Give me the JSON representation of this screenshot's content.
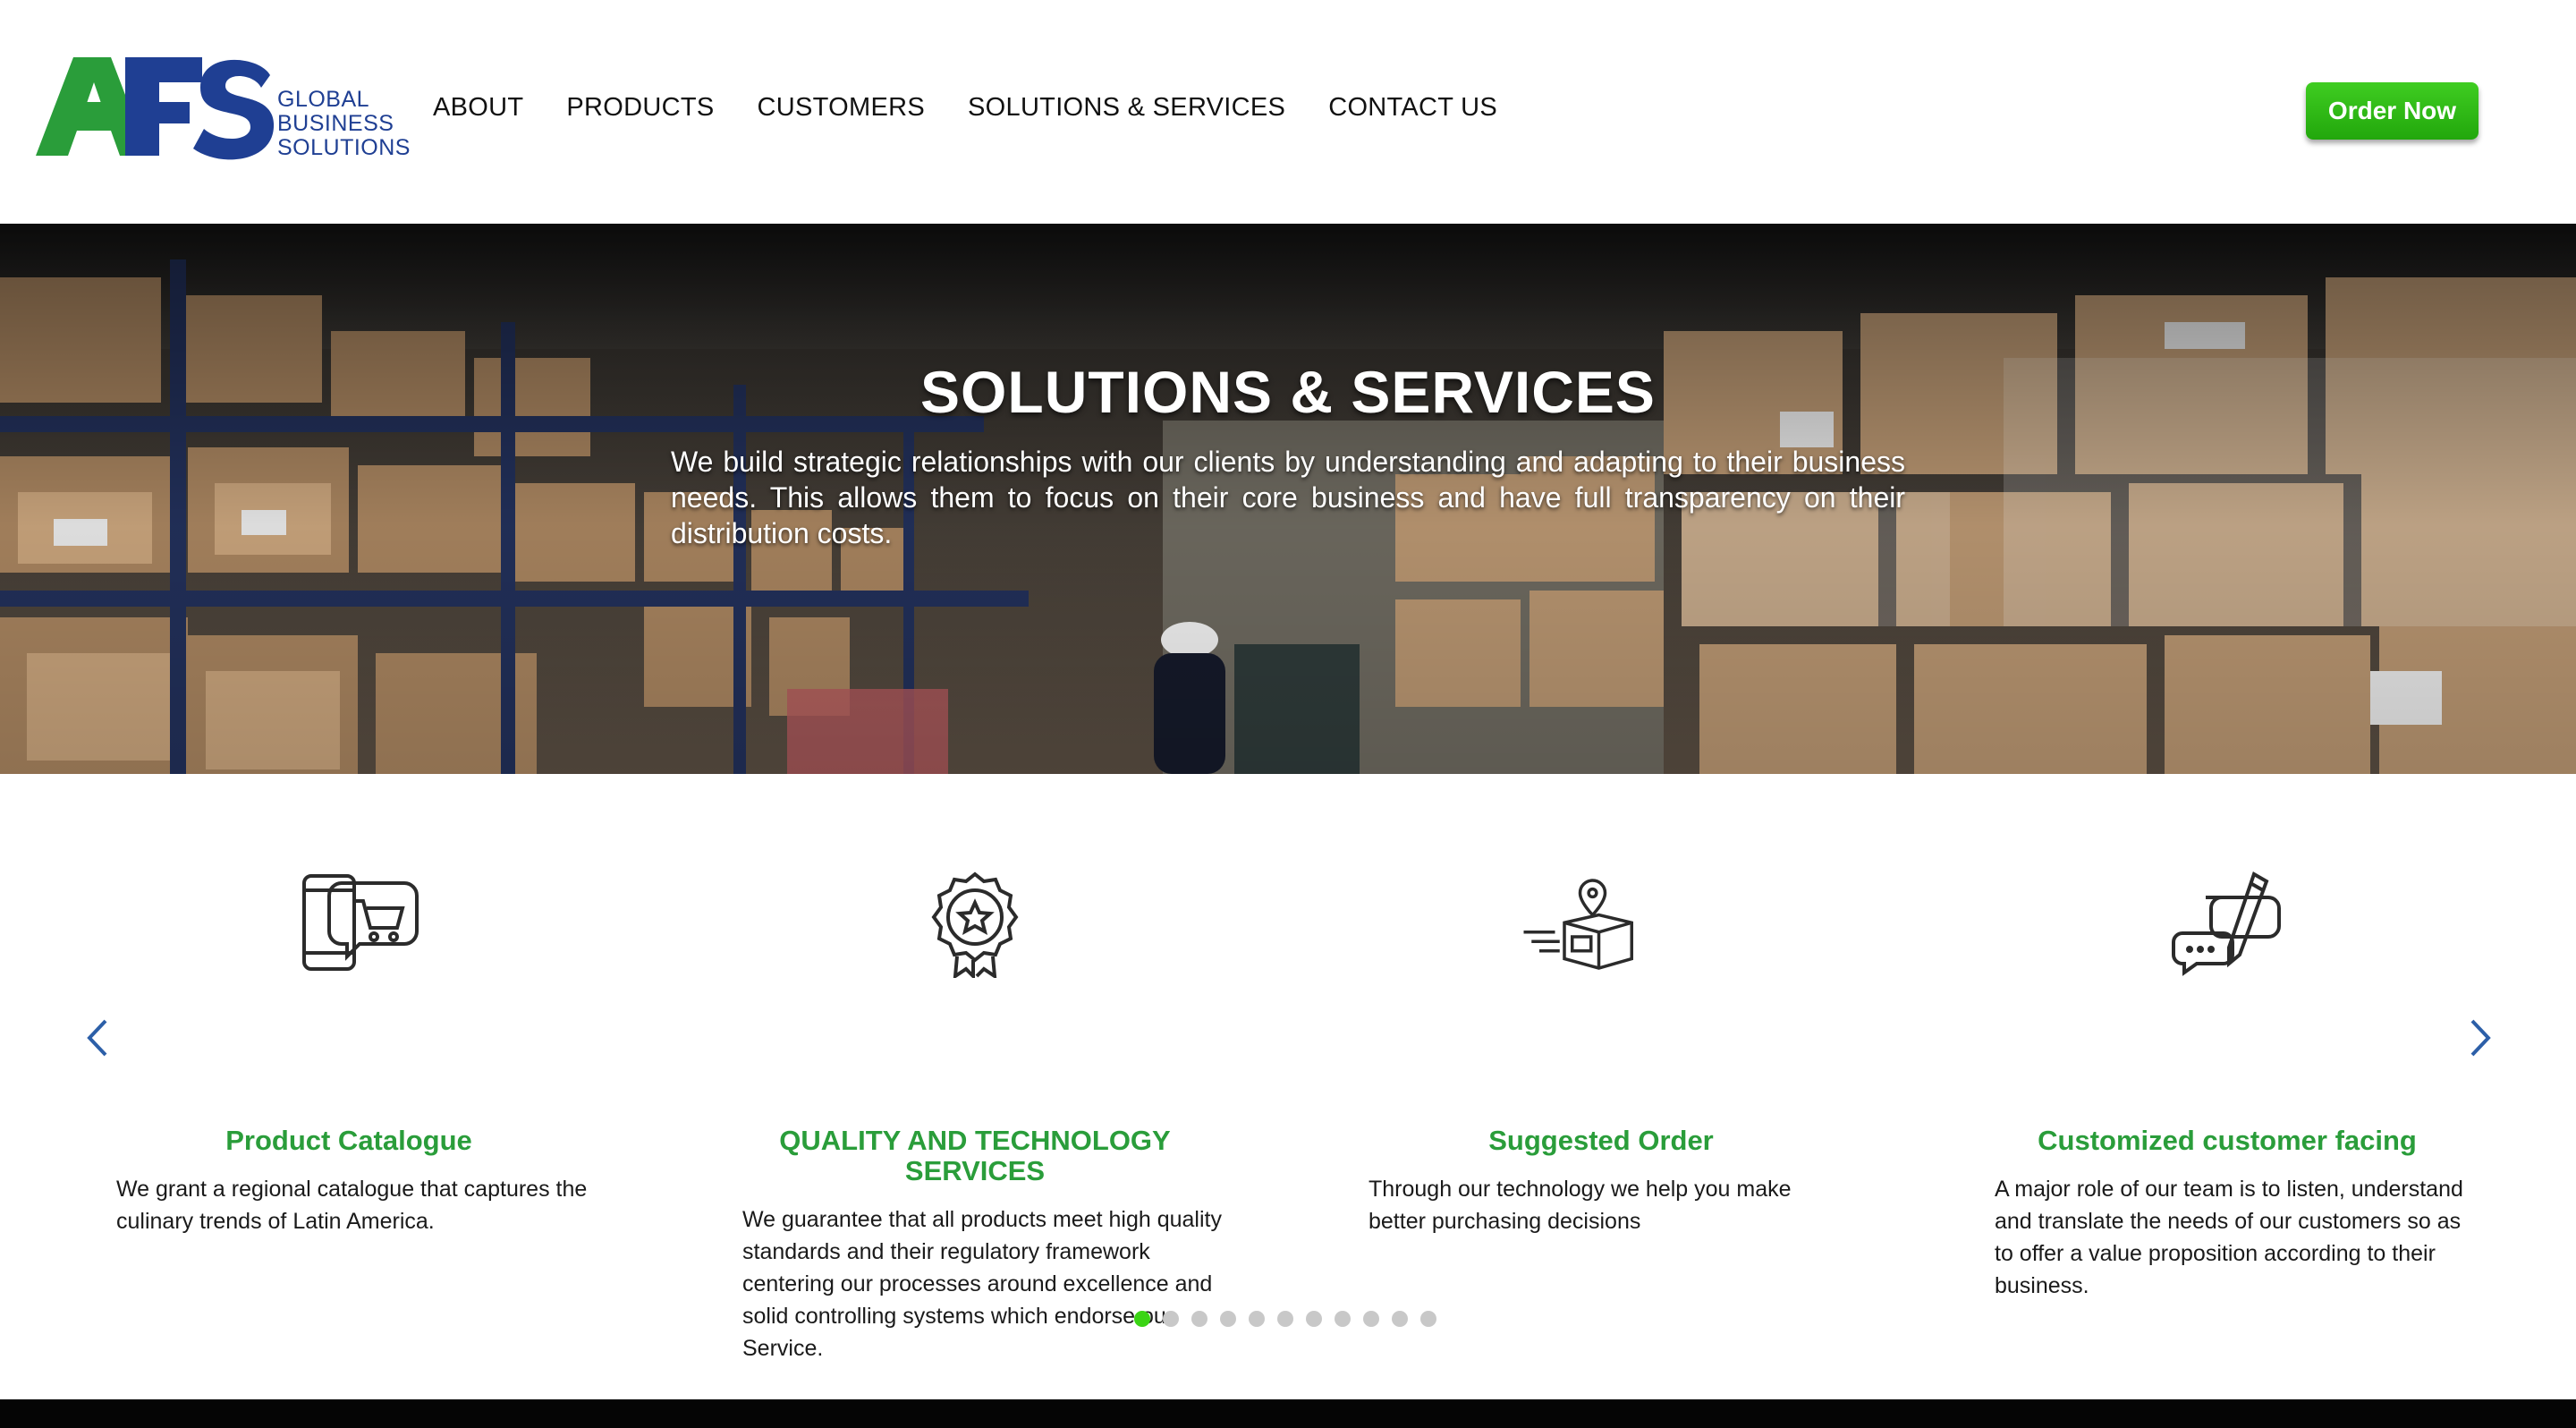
{
  "brand": {
    "logo_letters": "AFS",
    "tagline": [
      "GLOBAL",
      "BUSINESS",
      "SOLUTIONS"
    ],
    "green": "#2a9d3a",
    "blue": "#1f3f93"
  },
  "nav": {
    "items": [
      {
        "label": "ABOUT"
      },
      {
        "label": "PRODUCTS"
      },
      {
        "label": "CUSTOMERS"
      },
      {
        "label": "SOLUTIONS & SERVICES"
      },
      {
        "label": "CONTACT US"
      }
    ],
    "order_button": "Order Now",
    "order_button_color": "#2fbf16"
  },
  "hero": {
    "title": "SOLUTIONS & SERVICES",
    "text": "We build strategic relationships with our clients by understanding  and adapting to their business needs.  This allows them to focus on their core business and have full transparency on their distribution costs."
  },
  "services": {
    "cards": [
      {
        "icon": "mobile-cart-icon",
        "title": "Product Catalogue",
        "text": "We grant a regional catalogue that captures the culinary trends of Latin America."
      },
      {
        "icon": "award-badge-icon",
        "title": "QUALITY AND TECHNOLOGY SERVICES",
        "text": "We guarantee that all products meet high quality standards and their regulatory framework centering our processes around excellence and solid controlling systems which endorse our Service."
      },
      {
        "icon": "delivery-box-pin-icon",
        "title": "Suggested Order",
        "text": "Through our technology we help you make better purchasing decisions"
      },
      {
        "icon": "chat-pencil-icon",
        "title": "Customized customer facing",
        "text": "A major role of our team is to listen, understand and translate the needs of our customers so as to offer a value proposition according to their business."
      }
    ],
    "pagination": {
      "count": 11,
      "active": 1,
      "active_color": "#3ad414"
    }
  }
}
